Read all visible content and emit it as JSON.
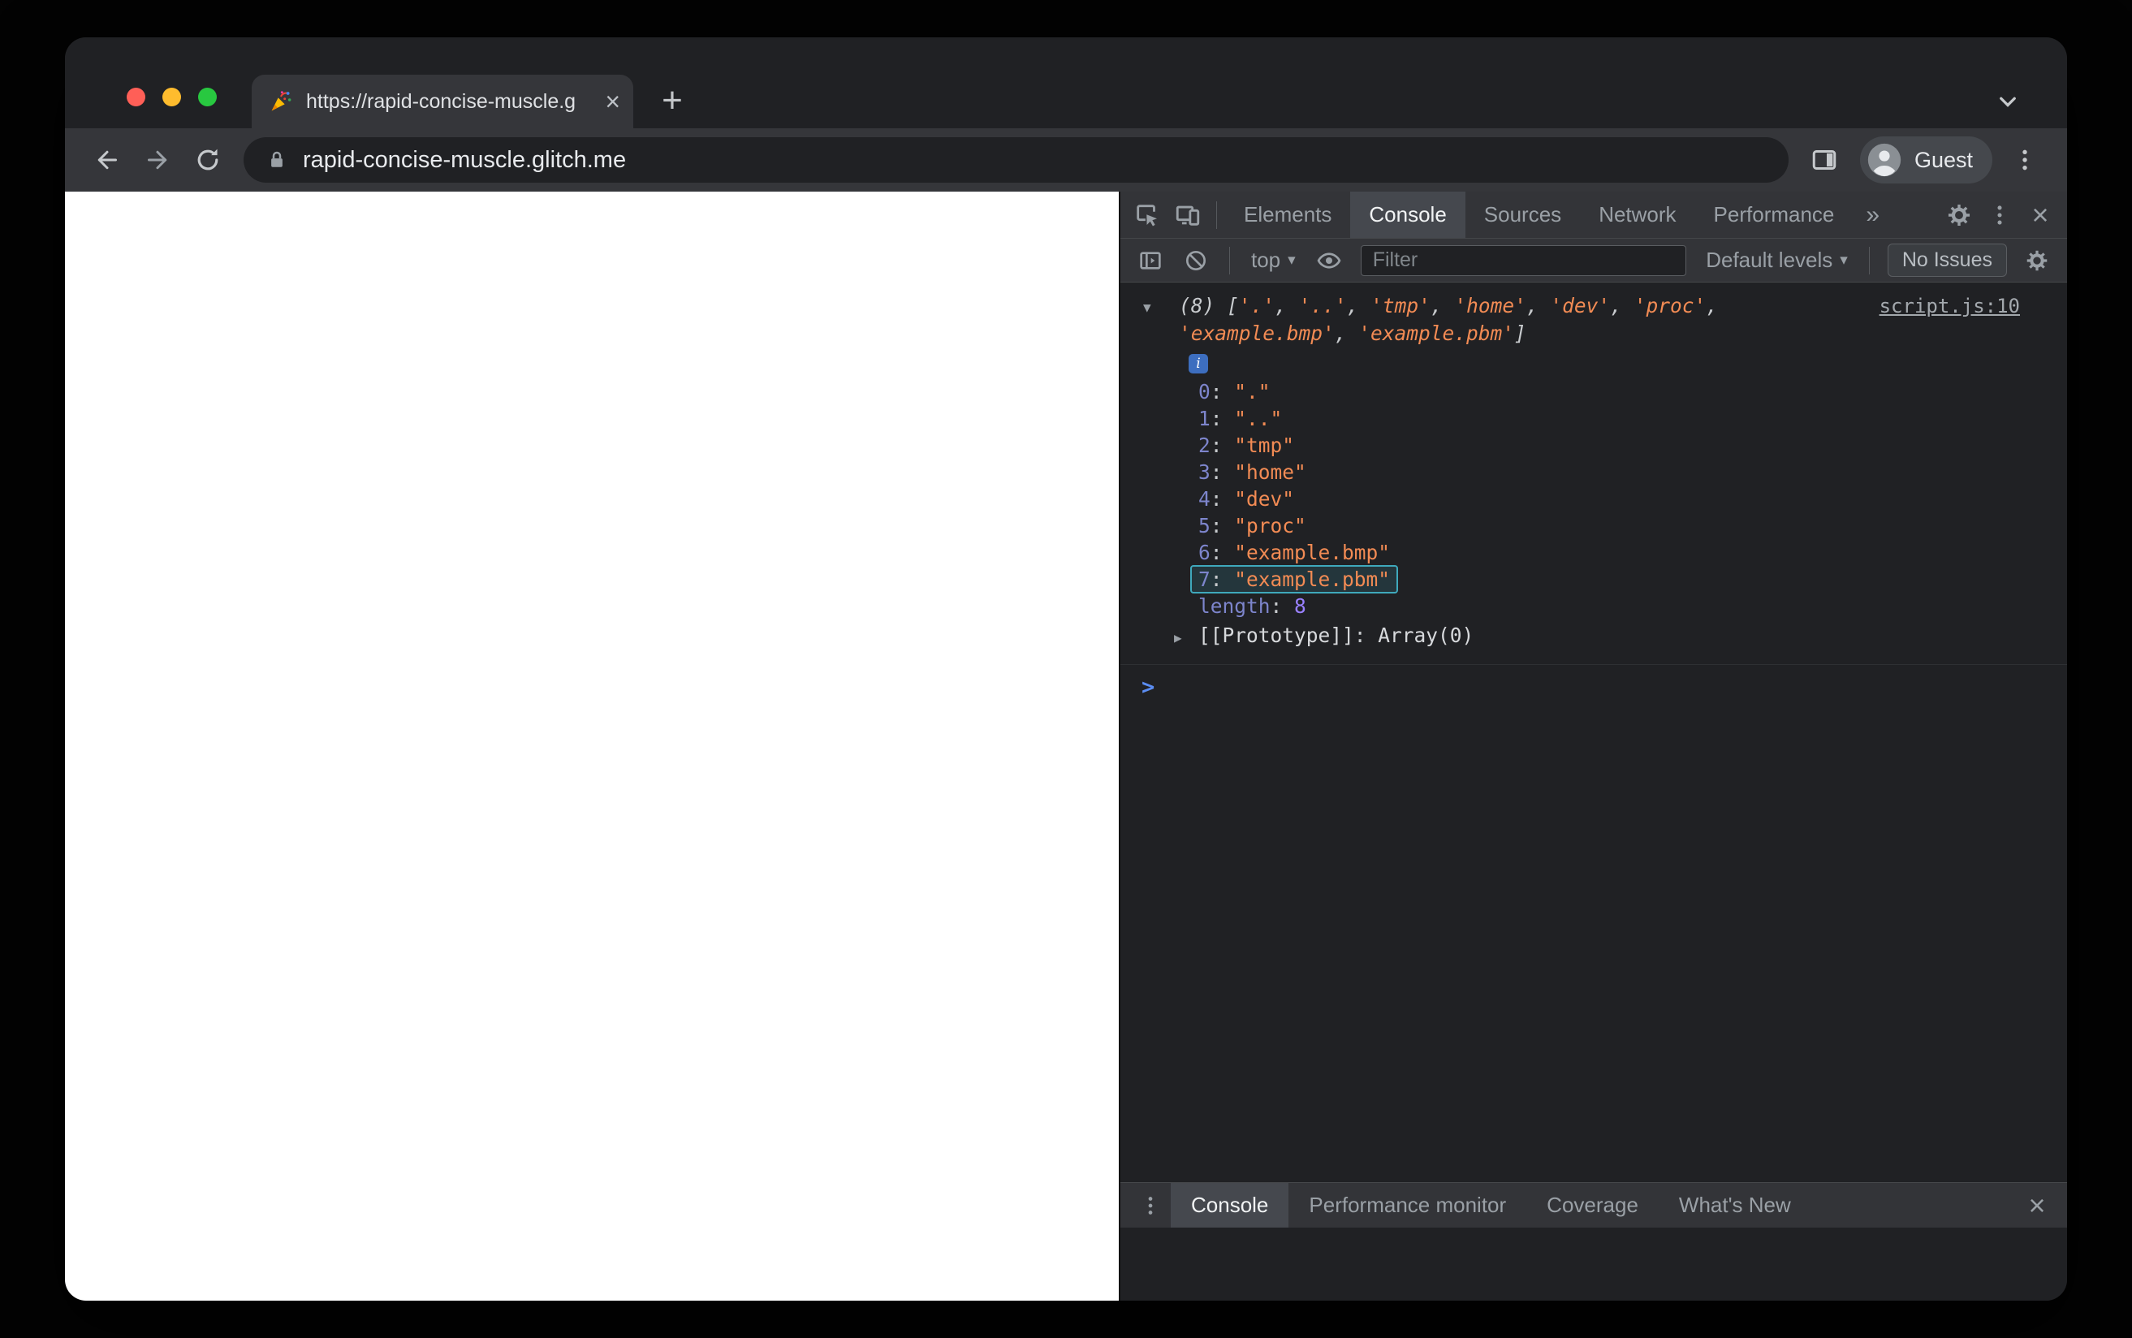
{
  "browser": {
    "tab_title": "https://rapid-concise-muscle.g",
    "url": "rapid-concise-muscle.glitch.me",
    "profile_label": "Guest"
  },
  "devtools": {
    "main_tabs": [
      "Elements",
      "Console",
      "Sources",
      "Network",
      "Performance"
    ],
    "active_main_tab": "Console",
    "toolbar": {
      "context_label": "top",
      "filter_placeholder": "Filter",
      "levels_label": "Default levels",
      "issues_label": "No Issues"
    },
    "console": {
      "source_link": "script.js:10",
      "count_prefix": "(8)",
      "items": [
        ".",
        "..",
        "tmp",
        "home",
        "dev",
        "proc",
        "example.bmp",
        "example.pbm"
      ],
      "highlighted_index": 7,
      "length_label": "length",
      "length_value": "8",
      "prototype_label": "[[Prototype]]",
      "prototype_value": "Array(0)"
    },
    "drawer_tabs": [
      "Console",
      "Performance monitor",
      "Coverage",
      "What's New"
    ],
    "active_drawer_tab": "Console"
  },
  "icons": {
    "tab_close": "×",
    "new_tab": "+",
    "more_tabs": "»",
    "close": "×",
    "expand_open": "▼",
    "expand_closed": "▶",
    "dropdown_caret": "▾",
    "prompt_chevron": ">",
    "info_glyph": "i"
  },
  "colors": {
    "string_value": "#f28b54",
    "property_name": "#7d85cc",
    "number_value": "#9980ff",
    "highlight_border": "#3fa9bc",
    "link_text": "#a3a8ad",
    "prompt": "#5b8df2",
    "traffic_red": "#ff5f57",
    "traffic_yellow": "#febc2e",
    "traffic_green": "#28c840"
  }
}
